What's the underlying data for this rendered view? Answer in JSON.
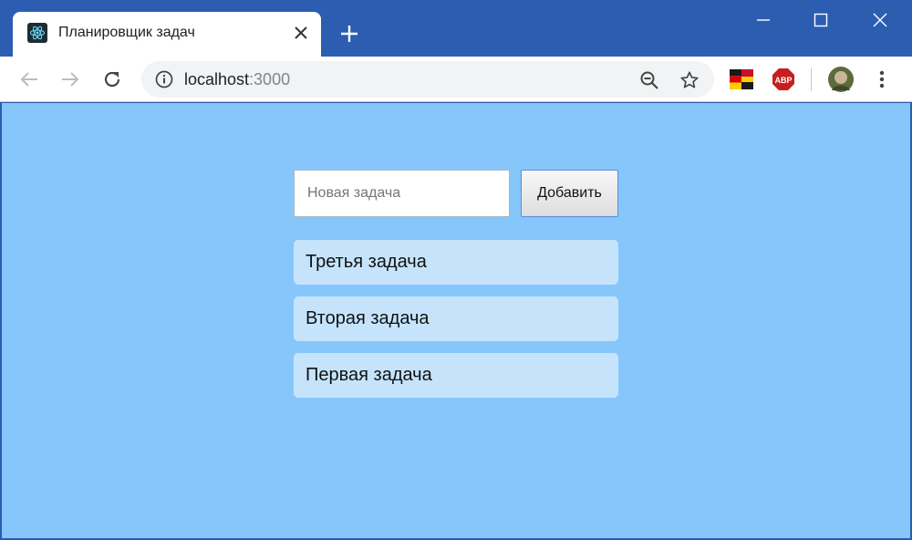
{
  "browser": {
    "tab_title": "Планировщик задач",
    "url_host": "localhost",
    "url_port": ":3000"
  },
  "icons": {
    "favicon": "react-atom-icon",
    "close": "close-icon",
    "new_tab": "plus-icon",
    "back": "back-arrow-icon",
    "forward": "forward-arrow-icon",
    "reload": "reload-icon",
    "info": "info-icon",
    "zoom": "zoom-out-icon",
    "bookmark": "star-icon",
    "menu": "kebab-menu-icon"
  },
  "extensions": {
    "abp_label": "ABP"
  },
  "app": {
    "input_placeholder": "Новая задача",
    "add_button": "Добавить",
    "tasks": [
      {
        "label": "Третья задача"
      },
      {
        "label": "Вторая задача"
      },
      {
        "label": "Первая задача"
      }
    ]
  },
  "colors": {
    "page_background": "#87c6fa",
    "task_background": "#c5e4fc",
    "titlebar": "#2d5db1"
  }
}
